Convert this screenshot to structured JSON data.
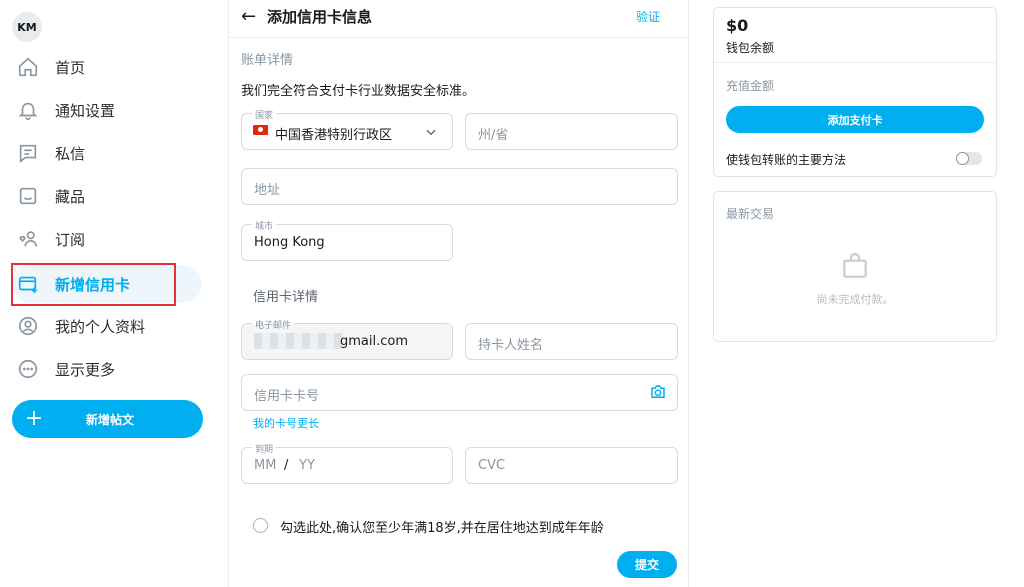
{
  "sidebar": {
    "avatar_initials": "KM",
    "items": [
      {
        "label": "首页",
        "icon": "home-icon"
      },
      {
        "label": "通知设置",
        "icon": "bell-icon"
      },
      {
        "label": "私信",
        "icon": "message-icon"
      },
      {
        "label": "藏品",
        "icon": "collection-icon"
      },
      {
        "label": "订阅",
        "icon": "subscriptions-icon"
      },
      {
        "label": "新增信用卡",
        "icon": "add-card-icon",
        "active": true
      },
      {
        "label": "我的个人资料",
        "icon": "profile-icon"
      },
      {
        "label": "显示更多",
        "icon": "more-icon"
      }
    ],
    "new_post_label": "新增帖文"
  },
  "header": {
    "title": "添加信用卡信息",
    "verify_label": "验证"
  },
  "form": {
    "billing_section": "账单详情",
    "notice": "我们完全符合支付卡行业数据安全标准。",
    "country": {
      "label": "国家",
      "value": "中国香港特别行政区"
    },
    "state": {
      "placeholder": "州/省"
    },
    "address": {
      "placeholder": "地址"
    },
    "city": {
      "label": "城市",
      "value": "Hong Kong"
    },
    "card_section": "信用卡详情",
    "email": {
      "label": "电子邮件",
      "value": "gmail.com"
    },
    "cardholder": {
      "placeholder": "持卡人姓名"
    },
    "card_number": {
      "placeholder": "信用卡卡号"
    },
    "longer_card_link": "我的卡号更长",
    "expiry": {
      "label": "到期",
      "mm": "MM",
      "sep": "/",
      "yy": "YY"
    },
    "cvc": {
      "placeholder": "CVC"
    },
    "age_confirm": "勾选此处,确认您至少年满18岁,并在居住地达到成年年龄",
    "submit_label": "提交"
  },
  "wallet": {
    "balance": "$0",
    "balance_label": "钱包余额",
    "topup_label": "充值金额",
    "add_card_label": "添加支付卡",
    "primary_method_label": "使钱包转账的主要方法",
    "primary_method_on": false
  },
  "transactions": {
    "title": "最新交易",
    "empty_text": "尚未完成付款。"
  },
  "colors": {
    "accent": "#00aff0",
    "highlight": "#e63232"
  }
}
